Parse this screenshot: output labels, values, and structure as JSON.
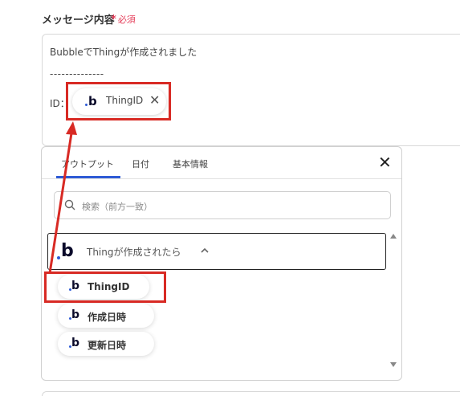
{
  "field": {
    "label": "メッセージ内容",
    "required_star": "*",
    "required_text": "必須"
  },
  "message": {
    "line1": "BubbleでThingが作成されました",
    "line2": "--------------",
    "id_label": "ID：",
    "chip_label": "ThingID",
    "chip_remove_glyph": "✕"
  },
  "panel": {
    "tabs": [
      {
        "label": "アウトプット",
        "active": true
      },
      {
        "label": "日付",
        "active": false
      },
      {
        "label": "基本情報",
        "active": false
      }
    ],
    "close_glyph": "✕",
    "search": {
      "placeholder": "検索（前方一致）"
    },
    "group": {
      "label": "Thingが作成されたら",
      "expanded": true
    },
    "items": [
      {
        "label": "ThingID",
        "highlighted": true
      },
      {
        "label": "作成日時",
        "highlighted": false
      },
      {
        "label": "更新日時",
        "highlighted": false
      }
    ]
  },
  "icons": {
    "app_logo": "b",
    "search": "search-icon",
    "chevron": "chevron-up-icon",
    "close": "close-icon"
  },
  "colors": {
    "accent": "#2f5bd6",
    "highlight": "#d82a24",
    "required": "#e53e5a",
    "border": "#d0d0d0"
  }
}
